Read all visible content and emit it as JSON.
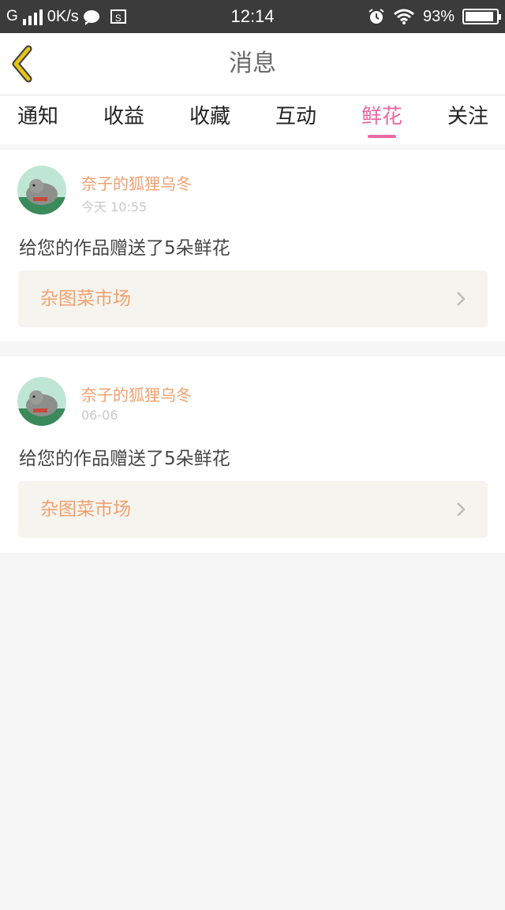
{
  "status_bar": {
    "network": "G",
    "speed": "0K/s",
    "s_badge": "S",
    "time": "12:14",
    "battery": "93%",
    "battery_level": 0.93
  },
  "header": {
    "title": "消息",
    "back_icon": "chevron-left-icon",
    "back_color": "#e4c419"
  },
  "tabs": [
    {
      "label": "通知"
    },
    {
      "label": "收益"
    },
    {
      "label": "收藏"
    },
    {
      "label": "互动"
    },
    {
      "label": "鲜花",
      "active": true
    },
    {
      "label": "关注"
    }
  ],
  "messages": [
    {
      "username": "奈子的狐狸乌冬",
      "time": "今天 10:55",
      "text": "给您的作品赠送了5朵鲜花",
      "link_label": "杂图菜市场"
    },
    {
      "username": "奈子的狐狸乌冬",
      "time": "06-06",
      "text": "给您的作品赠送了5朵鲜花",
      "link_label": "杂图菜市场"
    }
  ],
  "colors": {
    "accent": "#e96aa4",
    "username": "#f0a170",
    "background": "#f6f6f6"
  }
}
